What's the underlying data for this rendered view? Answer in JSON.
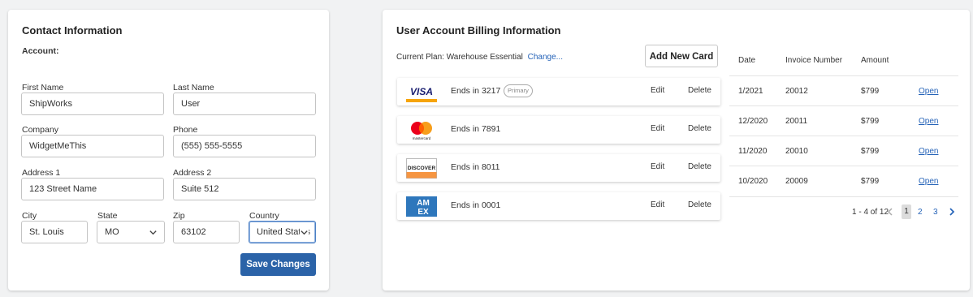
{
  "contact": {
    "title": "Contact Information",
    "account_label": "Account:",
    "first_name": {
      "label": "First Name",
      "value": "ShipWorks"
    },
    "last_name": {
      "label": "Last Name",
      "value": "User"
    },
    "company": {
      "label": "Company",
      "value": "WidgetMeThis"
    },
    "phone": {
      "label": "Phone",
      "value": "(555) 555-5555"
    },
    "address1": {
      "label": "Address 1",
      "value": "123 Street Name"
    },
    "address2": {
      "label": "Address 2",
      "value": "Suite 512"
    },
    "city": {
      "label": "City",
      "value": "St. Louis"
    },
    "state": {
      "label": "State",
      "value": "MO"
    },
    "zip": {
      "label": "Zip",
      "value": "63102"
    },
    "country": {
      "label": "Country",
      "value": "United States"
    },
    "save_label": "Save Changes"
  },
  "billing": {
    "title": "User Account Billing Information",
    "plan_prefix": "Current Plan: Warehouse Essential",
    "change_link": "Change...",
    "add_card_label": "Add New Card",
    "cards": [
      {
        "brand": "visa-logo",
        "ends": "Ends in 3217",
        "badge": "Primary",
        "edit": "Edit",
        "delete": "Delete"
      },
      {
        "brand": "mastercard-logo",
        "ends": "Ends in 7891",
        "edit": "Edit",
        "delete": "Delete"
      },
      {
        "brand": "discover-logo",
        "ends": "Ends in 8011",
        "edit": "Edit",
        "delete": "Delete"
      },
      {
        "brand": "amex-logo",
        "ends": "Ends in 0001",
        "edit": "Edit",
        "delete": "Delete"
      }
    ],
    "logo_text": {
      "visa": "VISA",
      "mastercard": "mastercard",
      "discover": "DISCOVER",
      "amex_top": "AM",
      "amex_bottom": "EX"
    },
    "invoices": {
      "headers": [
        "Date",
        "Invoice Number",
        "Amount"
      ],
      "rows": [
        {
          "date": "1/2021",
          "number": "20012",
          "amount": "$799",
          "action": "Open"
        },
        {
          "date": "12/2020",
          "number": "20011",
          "amount": "$799",
          "action": "Open"
        },
        {
          "date": "11/2020",
          "number": "20010",
          "amount": "$799",
          "action": "Open"
        },
        {
          "date": "10/2020",
          "number": "20009",
          "amount": "$799",
          "action": "Open"
        }
      ],
      "pagination": {
        "summary": "1 - 4 of 12",
        "pages": [
          "1",
          "2",
          "3"
        ],
        "current": "1"
      }
    }
  },
  "colors": {
    "primary_button": "#2b63a8",
    "link": "#2563b8",
    "background": "#f1f2f3"
  }
}
